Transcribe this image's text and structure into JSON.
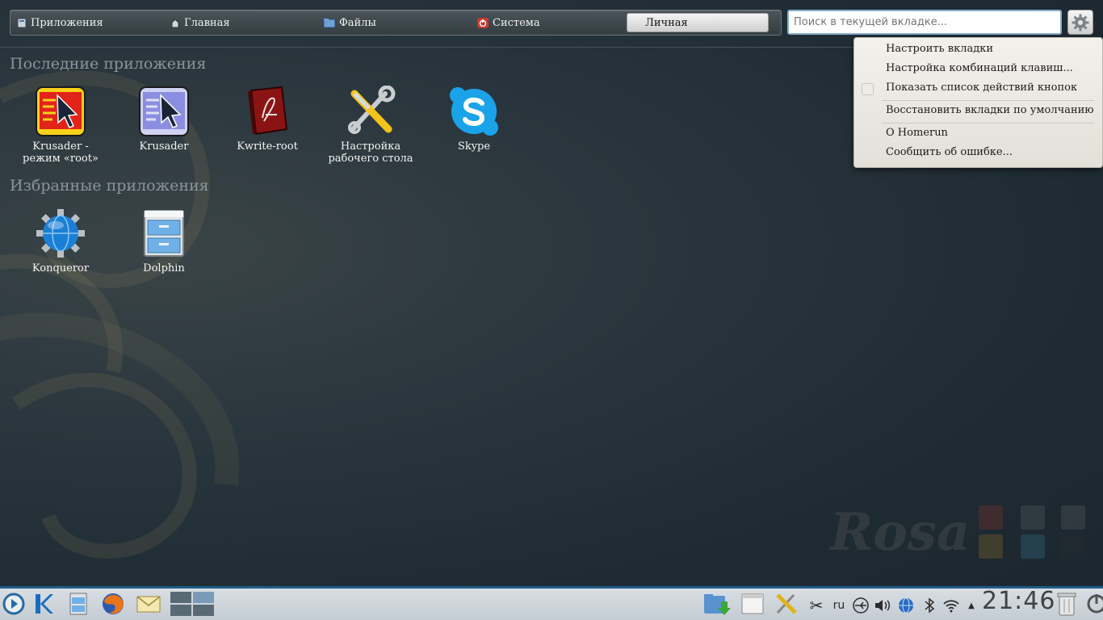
{
  "tabs": [
    {
      "label": "Приложения",
      "icon": "apps-tab-icon"
    },
    {
      "label": "Главная",
      "icon": "home-icon"
    },
    {
      "label": "Файлы",
      "icon": "folder-icon"
    },
    {
      "label": "Система",
      "icon": "system-icon"
    },
    {
      "label": "Личная",
      "icon": "",
      "active": true
    }
  ],
  "search": {
    "placeholder": "Поиск в текущей вкладке..."
  },
  "recent": {
    "title": "Последние приложения",
    "apps": [
      {
        "label": "Krusader - режим «root»",
        "icon": "krusader-root-icon"
      },
      {
        "label": "Krusader",
        "icon": "krusader-icon"
      },
      {
        "label": "Kwrite-root",
        "icon": "kwrite-icon"
      },
      {
        "label": "Настройка рабочего стола",
        "icon": "tools-icon"
      },
      {
        "label": "Skype",
        "icon": "skype-icon"
      }
    ]
  },
  "favorites": {
    "title": "Избранные приложения",
    "apps": [
      {
        "label": "Konqueror",
        "icon": "konqueror-icon"
      },
      {
        "label": "Dolphin",
        "icon": "dolphin-icon"
      }
    ]
  },
  "menu": {
    "items": [
      "Настроить вкладки",
      "Настройка комбинаций клавиш...",
      "Показать список действий кнопок",
      "Восстановить вкладки по умолчанию",
      "О Homerun",
      "Сообщить об ошибке..."
    ]
  },
  "watermark": "Rosa",
  "tray": {
    "lang": "ru",
    "clock": "21:46"
  },
  "colors": {
    "accent": "#1e5b8a",
    "background": "#243038",
    "menu_bg": "#efece6"
  }
}
